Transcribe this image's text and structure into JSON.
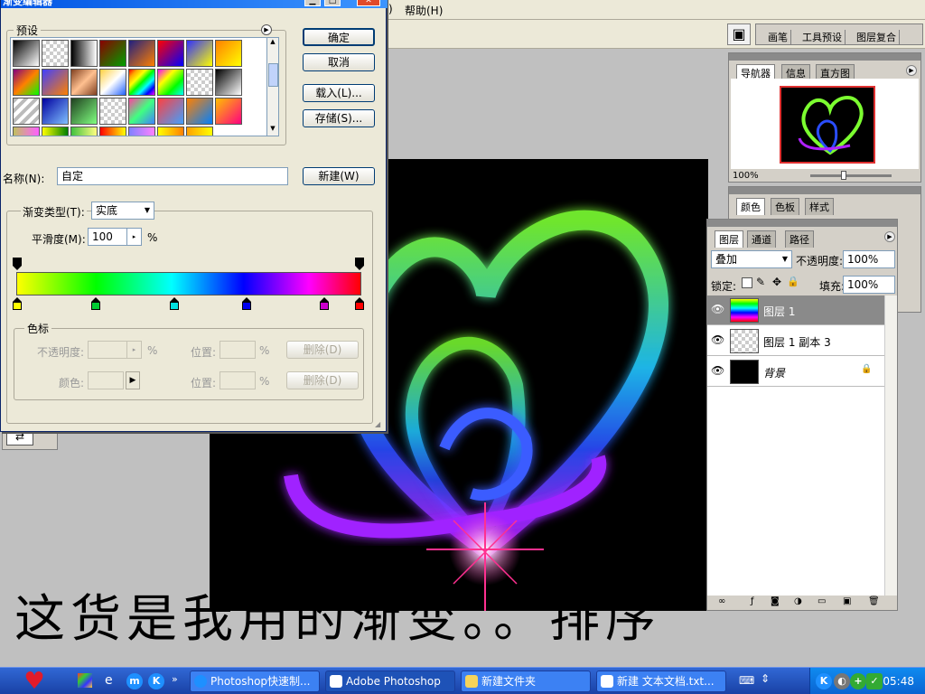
{
  "menu": {
    "partial_label": ")",
    "help_label": "帮助(H)"
  },
  "palette_well": {
    "tabs": [
      "画笔",
      "工具预设",
      "图层复合"
    ],
    "icon": "palette-well-icon"
  },
  "gradient_editor": {
    "title": "渐变编辑器",
    "presets_label": "预设",
    "ok_label": "确定",
    "cancel_label": "取消",
    "load_label": "载入(L)...",
    "save_label": "存储(S)...",
    "name_label": "名称(N):",
    "name_value": "自定",
    "new_label": "新建(W)",
    "gradient_type_label": "渐变类型(T):",
    "gradient_type_value": "实底",
    "smoothness_label": "平滑度(M):",
    "smoothness_value": "100",
    "percent": "%",
    "stops_group_label": "色标",
    "opacity_label": "不透明度:",
    "location_label": "位置:",
    "delete_label": "删除(D)",
    "color_label": "颜色:",
    "color_stops": [
      "#ffff00",
      "#00cc33",
      "#00e0e0",
      "#0000ee",
      "#cc00cc",
      "#ff0000"
    ]
  },
  "navigator_panel": {
    "tabs": [
      "导航器",
      "信息",
      "直方图"
    ],
    "zoom_value": "100%"
  },
  "color_panel": {
    "tabs": [
      "颜色",
      "色板",
      "样式"
    ]
  },
  "layers_panel": {
    "tabs": [
      "图层",
      "通道",
      "路径"
    ],
    "blend_mode": "叠加",
    "opacity_label": "不透明度:",
    "opacity_value": "100%",
    "lock_label": "锁定:",
    "fill_label": "填充:",
    "fill_value": "100%",
    "layers": [
      {
        "name": "图层 1",
        "selected": true
      },
      {
        "name": "图层 1 副本 3",
        "selected": false
      },
      {
        "name": "背景",
        "selected": false
      }
    ]
  },
  "caption": "这货是我用的渐变。。排序",
  "taskbar": {
    "tasks": [
      {
        "label": "Photoshop快速制...",
        "active": false
      },
      {
        "label": "Adobe Photoshop",
        "active": true
      },
      {
        "label": "新建文件夹",
        "active": false
      },
      {
        "label": "新建 文本文档.txt...",
        "active": false
      }
    ],
    "clock": "05:48"
  },
  "colors": {
    "accent": "#0054e3",
    "taskbar": "#1941a5",
    "heart_green": "#7cff30",
    "heart_blue": "#2a4dff",
    "heart_purple": "#b020ff"
  }
}
